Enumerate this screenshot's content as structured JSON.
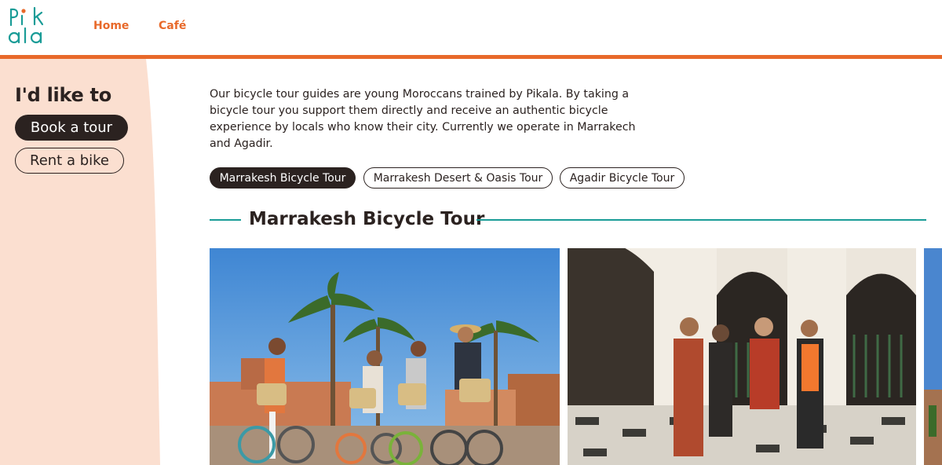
{
  "header": {
    "logo_text": "Pikala",
    "nav": [
      {
        "label": "Home"
      },
      {
        "label": "Café"
      }
    ]
  },
  "colors": {
    "accent": "#e8692a",
    "teal": "#1a9c97",
    "dark": "#2b2220",
    "sidebar_bg": "#fbdfd0"
  },
  "sidebar": {
    "title": "I'd like to",
    "book_label": "Book a tour",
    "rent_label": "Rent a bike"
  },
  "main": {
    "intro": "Our bicycle tour guides are young Moroccans trained by Pikala. By taking a bicycle tour you support them directly and receive an authentic bicycle experience by locals who know their city. Currently we operate in Marrakech and Agadir.",
    "tabs": [
      {
        "label": "Marrakesh Bicycle Tour",
        "active": true
      },
      {
        "label": "Marrakesh Desert & Oasis Tour",
        "active": false
      },
      {
        "label": "Agadir Bicycle Tour",
        "active": false
      }
    ],
    "section_title": "Marrakesh Bicycle Tour"
  }
}
